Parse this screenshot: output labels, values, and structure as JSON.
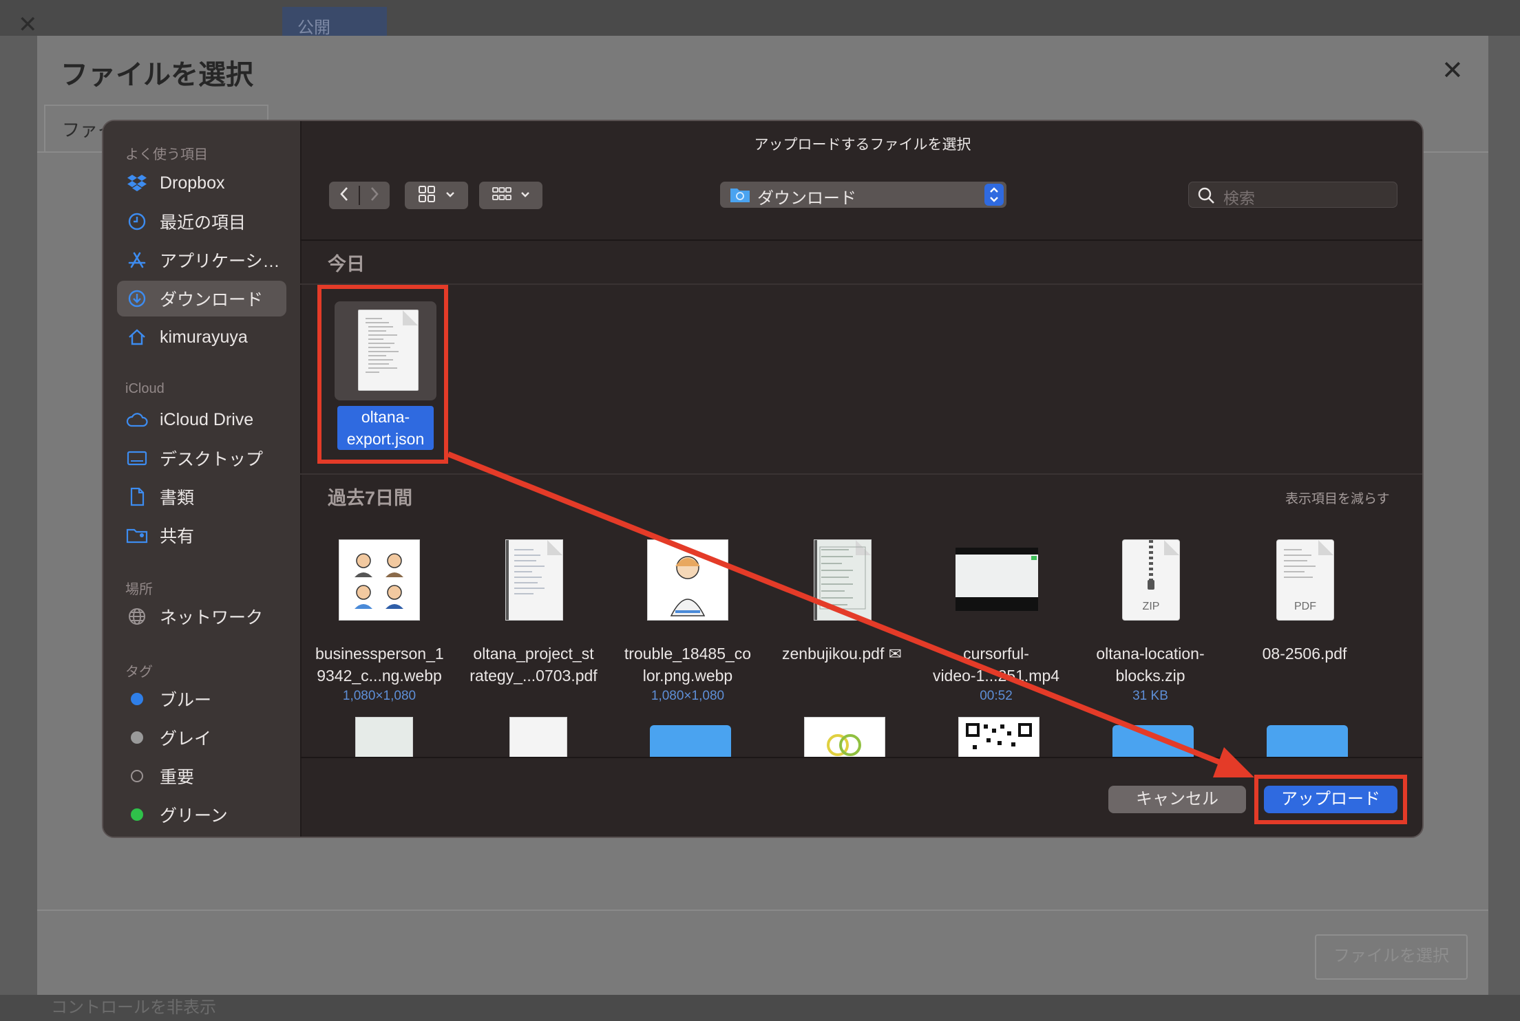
{
  "background": {
    "publish_label": "公開",
    "controls_label": "コントロールを非表示"
  },
  "web_modal": {
    "title": "ファイルを選択",
    "tab_label": "ファイ",
    "select_button": "ファイルを選択"
  },
  "dialog": {
    "title": "アップロードするファイルを選択",
    "location": "ダウンロード",
    "search_placeholder": "検索",
    "sidebar": {
      "favorites_header": "よく使う項目",
      "favorites": [
        {
          "label": "Dropbox",
          "icon": "dropbox-icon"
        },
        {
          "label": "最近の項目",
          "icon": "clock-icon"
        },
        {
          "label": "アプリケーシ…",
          "icon": "applications-icon"
        },
        {
          "label": "ダウンロード",
          "icon": "download-icon",
          "selected": true
        },
        {
          "label": "kimurayuya",
          "icon": "home-icon"
        }
      ],
      "icloud_header": "iCloud",
      "icloud": [
        {
          "label": "iCloud Drive",
          "icon": "cloud-icon"
        },
        {
          "label": "デスクトップ",
          "icon": "desktop-icon"
        },
        {
          "label": "書類",
          "icon": "document-icon"
        },
        {
          "label": "共有",
          "icon": "shared-folder-icon"
        }
      ],
      "locations_header": "場所",
      "locations": [
        {
          "label": "ネットワーク",
          "icon": "network-icon"
        }
      ],
      "tags_header": "タグ",
      "tags": [
        {
          "label": "ブルー",
          "color": "#2f7fe8"
        },
        {
          "label": "グレイ",
          "color": "#9a9a9a"
        },
        {
          "label": "重要",
          "color": "none"
        },
        {
          "label": "グリーン",
          "color": "#2fc14a"
        }
      ]
    },
    "today_header": "今日",
    "today_files": [
      {
        "name_line1": "oltana-",
        "name_line2": "export.json",
        "selected": true
      }
    ],
    "past_header": "過去7日間",
    "show_less": "表示項目を減らす",
    "past_files": [
      {
        "name_line1": "businessperson_1",
        "name_line2": "9342_c...ng.webp",
        "meta": "1,080×1,080"
      },
      {
        "name_line1": "oltana_project_st",
        "name_line2": "rategy_...0703.pdf",
        "meta": ""
      },
      {
        "name_line1": "trouble_18485_co",
        "name_line2": "lor.png.webp",
        "meta": "1,080×1,080"
      },
      {
        "name_line1": "zenbujikou.pdf ✉",
        "name_line2": "",
        "meta": ""
      },
      {
        "name_line1": "cursorful-",
        "name_line2": "video-1...251.mp4",
        "meta": "00:52"
      },
      {
        "name_line1": "oltana-location-",
        "name_line2": "blocks.zip",
        "meta": "31 KB"
      },
      {
        "name_line1": "08-2506.pdf",
        "name_line2": "",
        "meta": ""
      }
    ],
    "zip_badge": "ZIP",
    "pdf_badge": "PDF",
    "cancel_button": "キャンセル",
    "upload_button": "アップロード"
  },
  "colors": {
    "accent": "#2f6ae0",
    "annotation_red": "#e43b28"
  }
}
